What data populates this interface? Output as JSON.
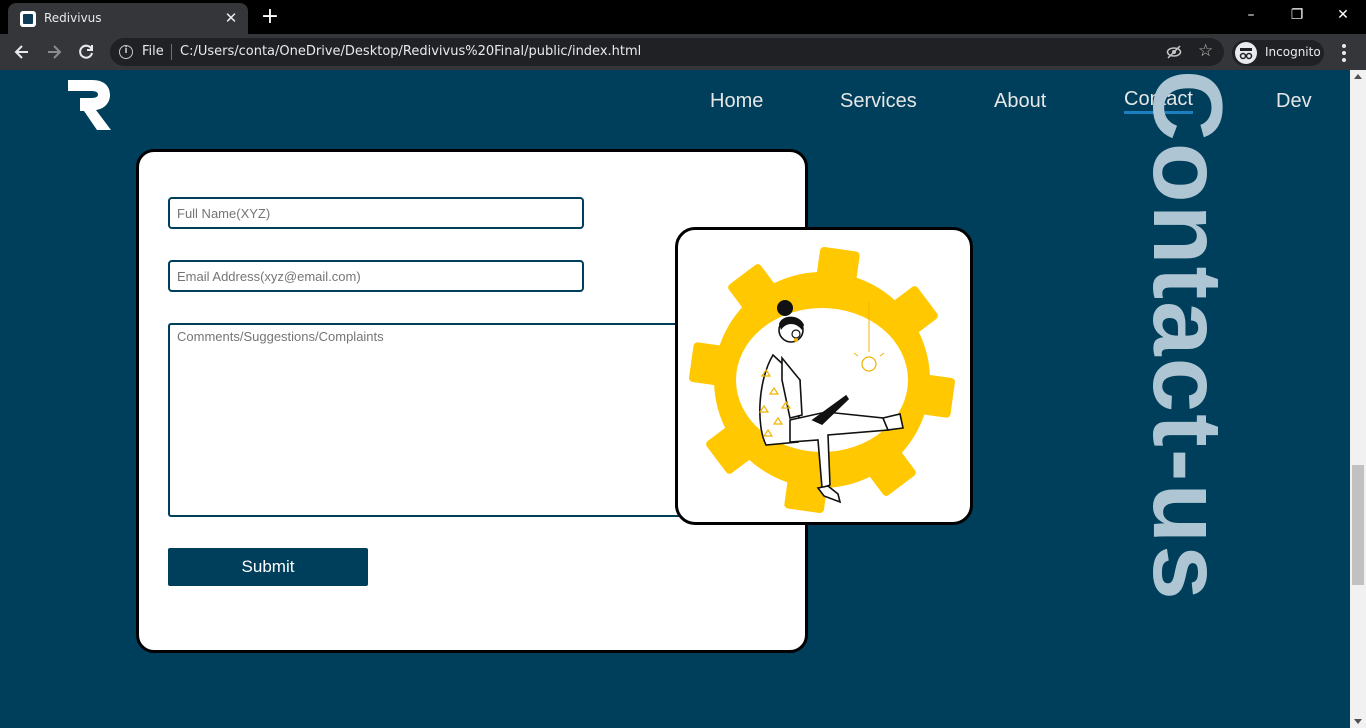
{
  "browser": {
    "tab_title": "Redivivus",
    "tab_close": "✕",
    "new_tab": "+",
    "window_controls": {
      "minimize": "–",
      "restore": "❐",
      "close": "✕"
    },
    "address_label": "File",
    "address_url": "C:/Users/conta/OneDrive/Desktop/Redivivus%20Final/public/index.html",
    "profile_label": "Incognito",
    "icons": [
      "back-icon",
      "forward-icon",
      "reload-icon",
      "info-icon",
      "eye-off-icon",
      "star-icon",
      "incognito-icon",
      "menu-icon"
    ]
  },
  "site": {
    "logo_icon": "redivivus-r-logo",
    "nav": {
      "home": "Home",
      "services": "Services",
      "about": "About",
      "contact": "Contact",
      "dev": "Dev"
    },
    "active_nav": "Contact",
    "section_title": "Contact-us",
    "form": {
      "name_placeholder": "Full Name(XYZ)",
      "email_placeholder": "Email Address(xyz@email.com)",
      "comments_placeholder": "Comments/Suggestions/Complaints",
      "submit_label": "Submit"
    },
    "illustration": "woman-with-laptop-in-gear-illustration",
    "colors": {
      "page_bg": "#003f5c",
      "accent_yellow": "#ffc800",
      "nav_underline": "#1c7fbf",
      "vertical_title": "#aec6d3"
    }
  }
}
